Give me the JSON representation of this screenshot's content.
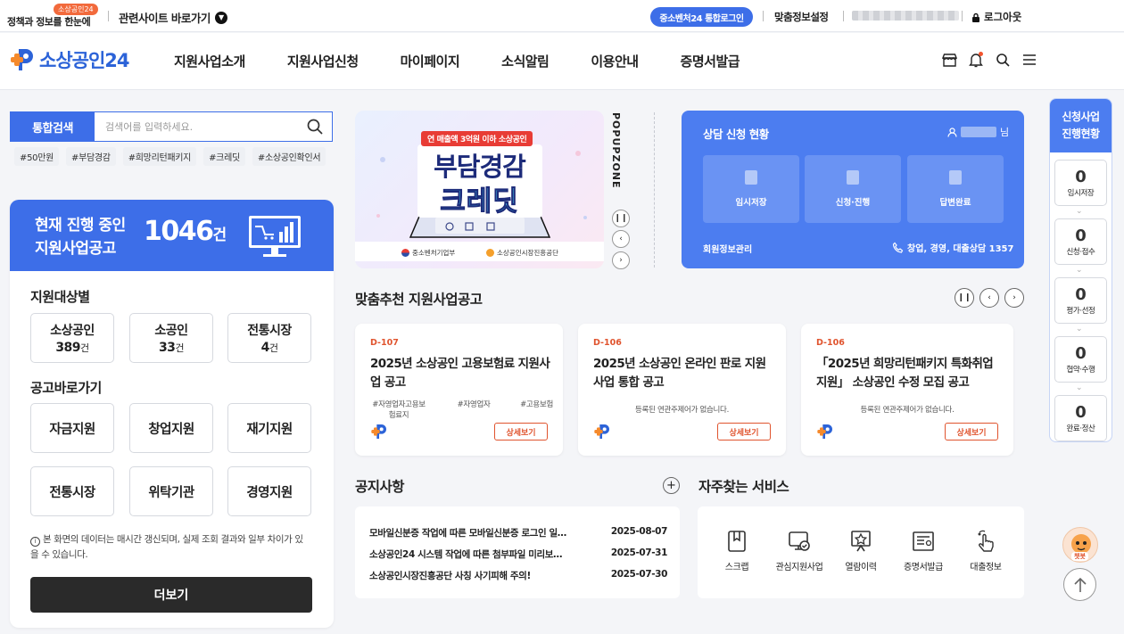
{
  "topbar": {
    "slogan": "정책과 정보를 한눈에",
    "slogan_badge": "소상공인24",
    "related_sites": "관련사이트 바로가기",
    "integrated_login": "중소벤처24 통합로그인",
    "custom_settings": "맞춤정보설정",
    "logout": "로그아웃"
  },
  "header": {
    "logo_text": "소상공인24",
    "nav": [
      "지원사업소개",
      "지원사업신청",
      "마이페이지",
      "소식알림",
      "이용안내",
      "증명서발급"
    ]
  },
  "search": {
    "tab_label": "통합검색",
    "placeholder": "검색어를 입력하세요.",
    "tags": [
      "#50만원",
      "#부담경감",
      "#희망리턴패키지",
      "#크레딧",
      "#소상공인확인서"
    ]
  },
  "ongoing": {
    "line1": "현재 진행 중인",
    "line2": "지원사업공고",
    "count": "1046",
    "unit": "건"
  },
  "targets": {
    "title": "지원대상별",
    "items": [
      {
        "label": "소상공인",
        "count": "389",
        "unit": "건"
      },
      {
        "label": "소공인",
        "count": "33",
        "unit": "건"
      },
      {
        "label": "전통시장",
        "count": "4",
        "unit": "건"
      }
    ]
  },
  "shortcuts": {
    "title": "공고바로가기",
    "items": [
      "자금지원",
      "창업지원",
      "재기지원",
      "전통시장",
      "위탁기관",
      "경영지원"
    ]
  },
  "notice_text": "본 화면의 데이터는 매시간 갱신되며, 실제 조회 결과와 일부 차이가 있을 수 있습니다.",
  "more_button": "더보기",
  "banner": {
    "ribbon": "연 매출액 3억원 이하 소상공인",
    "title1": "부담경감",
    "title2": "크레딧",
    "org1": "중소벤처기업부",
    "org2": "소상공인시장진흥공단",
    "zone_label": "POPUPZONE"
  },
  "consult": {
    "title": "상담 신청 현황",
    "user_suffix": "님",
    "boxes": [
      "임시저장",
      "신청·진행",
      "답변완료"
    ],
    "member_info": "회원정보관리",
    "phone": "창업, 경영, 대출상담 1357"
  },
  "recommend": {
    "title": "맞춤추천 지원사업공고",
    "detail_label": "상세보기",
    "cards": [
      {
        "dday": "D-107",
        "title": "2025년 소상공인 고용보험료 지원사업 공고",
        "tags": [
          "#자영업자고용보험료지",
          "#자영업자",
          "#고용보험"
        ],
        "none": ""
      },
      {
        "dday": "D-106",
        "title": "2025년 소상공인 온라인 판로 지원사업 통합 공고",
        "tags": [],
        "none": "등록된 연관주제어가 없습니다."
      },
      {
        "dday": "D-106",
        "title": "「2025년 희망리턴패키지 특화취업지원」 소상공인 수정 모집 공고",
        "tags": [],
        "none": "등록된 연관주제어가 없습니다."
      }
    ]
  },
  "notices": {
    "title": "공지사항",
    "items": [
      {
        "title": "모바일신분증 작업에 따른 모바일신분증 로그인 일…",
        "date": "2025-08-07"
      },
      {
        "title": "소상공인24 시스템 작업에 따른 첨부파일 미리보…",
        "date": "2025-07-31"
      },
      {
        "title": "소상공인시장진흥공단 사칭 사기피해 주의!",
        "date": "2025-07-30"
      }
    ]
  },
  "services": {
    "title": "자주찾는 서비스",
    "items": [
      "스크랩",
      "관심지원사업",
      "열람이력",
      "증명서발급",
      "대출정보"
    ]
  },
  "rail": {
    "title1": "신청사업",
    "title2": "진행현황",
    "steps": [
      {
        "count": "0",
        "label": "임시저장"
      },
      {
        "count": "0",
        "label": "신청·접수"
      },
      {
        "count": "0",
        "label": "평가·선정"
      },
      {
        "count": "0",
        "label": "협약·수행"
      },
      {
        "count": "0",
        "label": "완료·정산"
      }
    ]
  },
  "mascot_label": "챗봇"
}
